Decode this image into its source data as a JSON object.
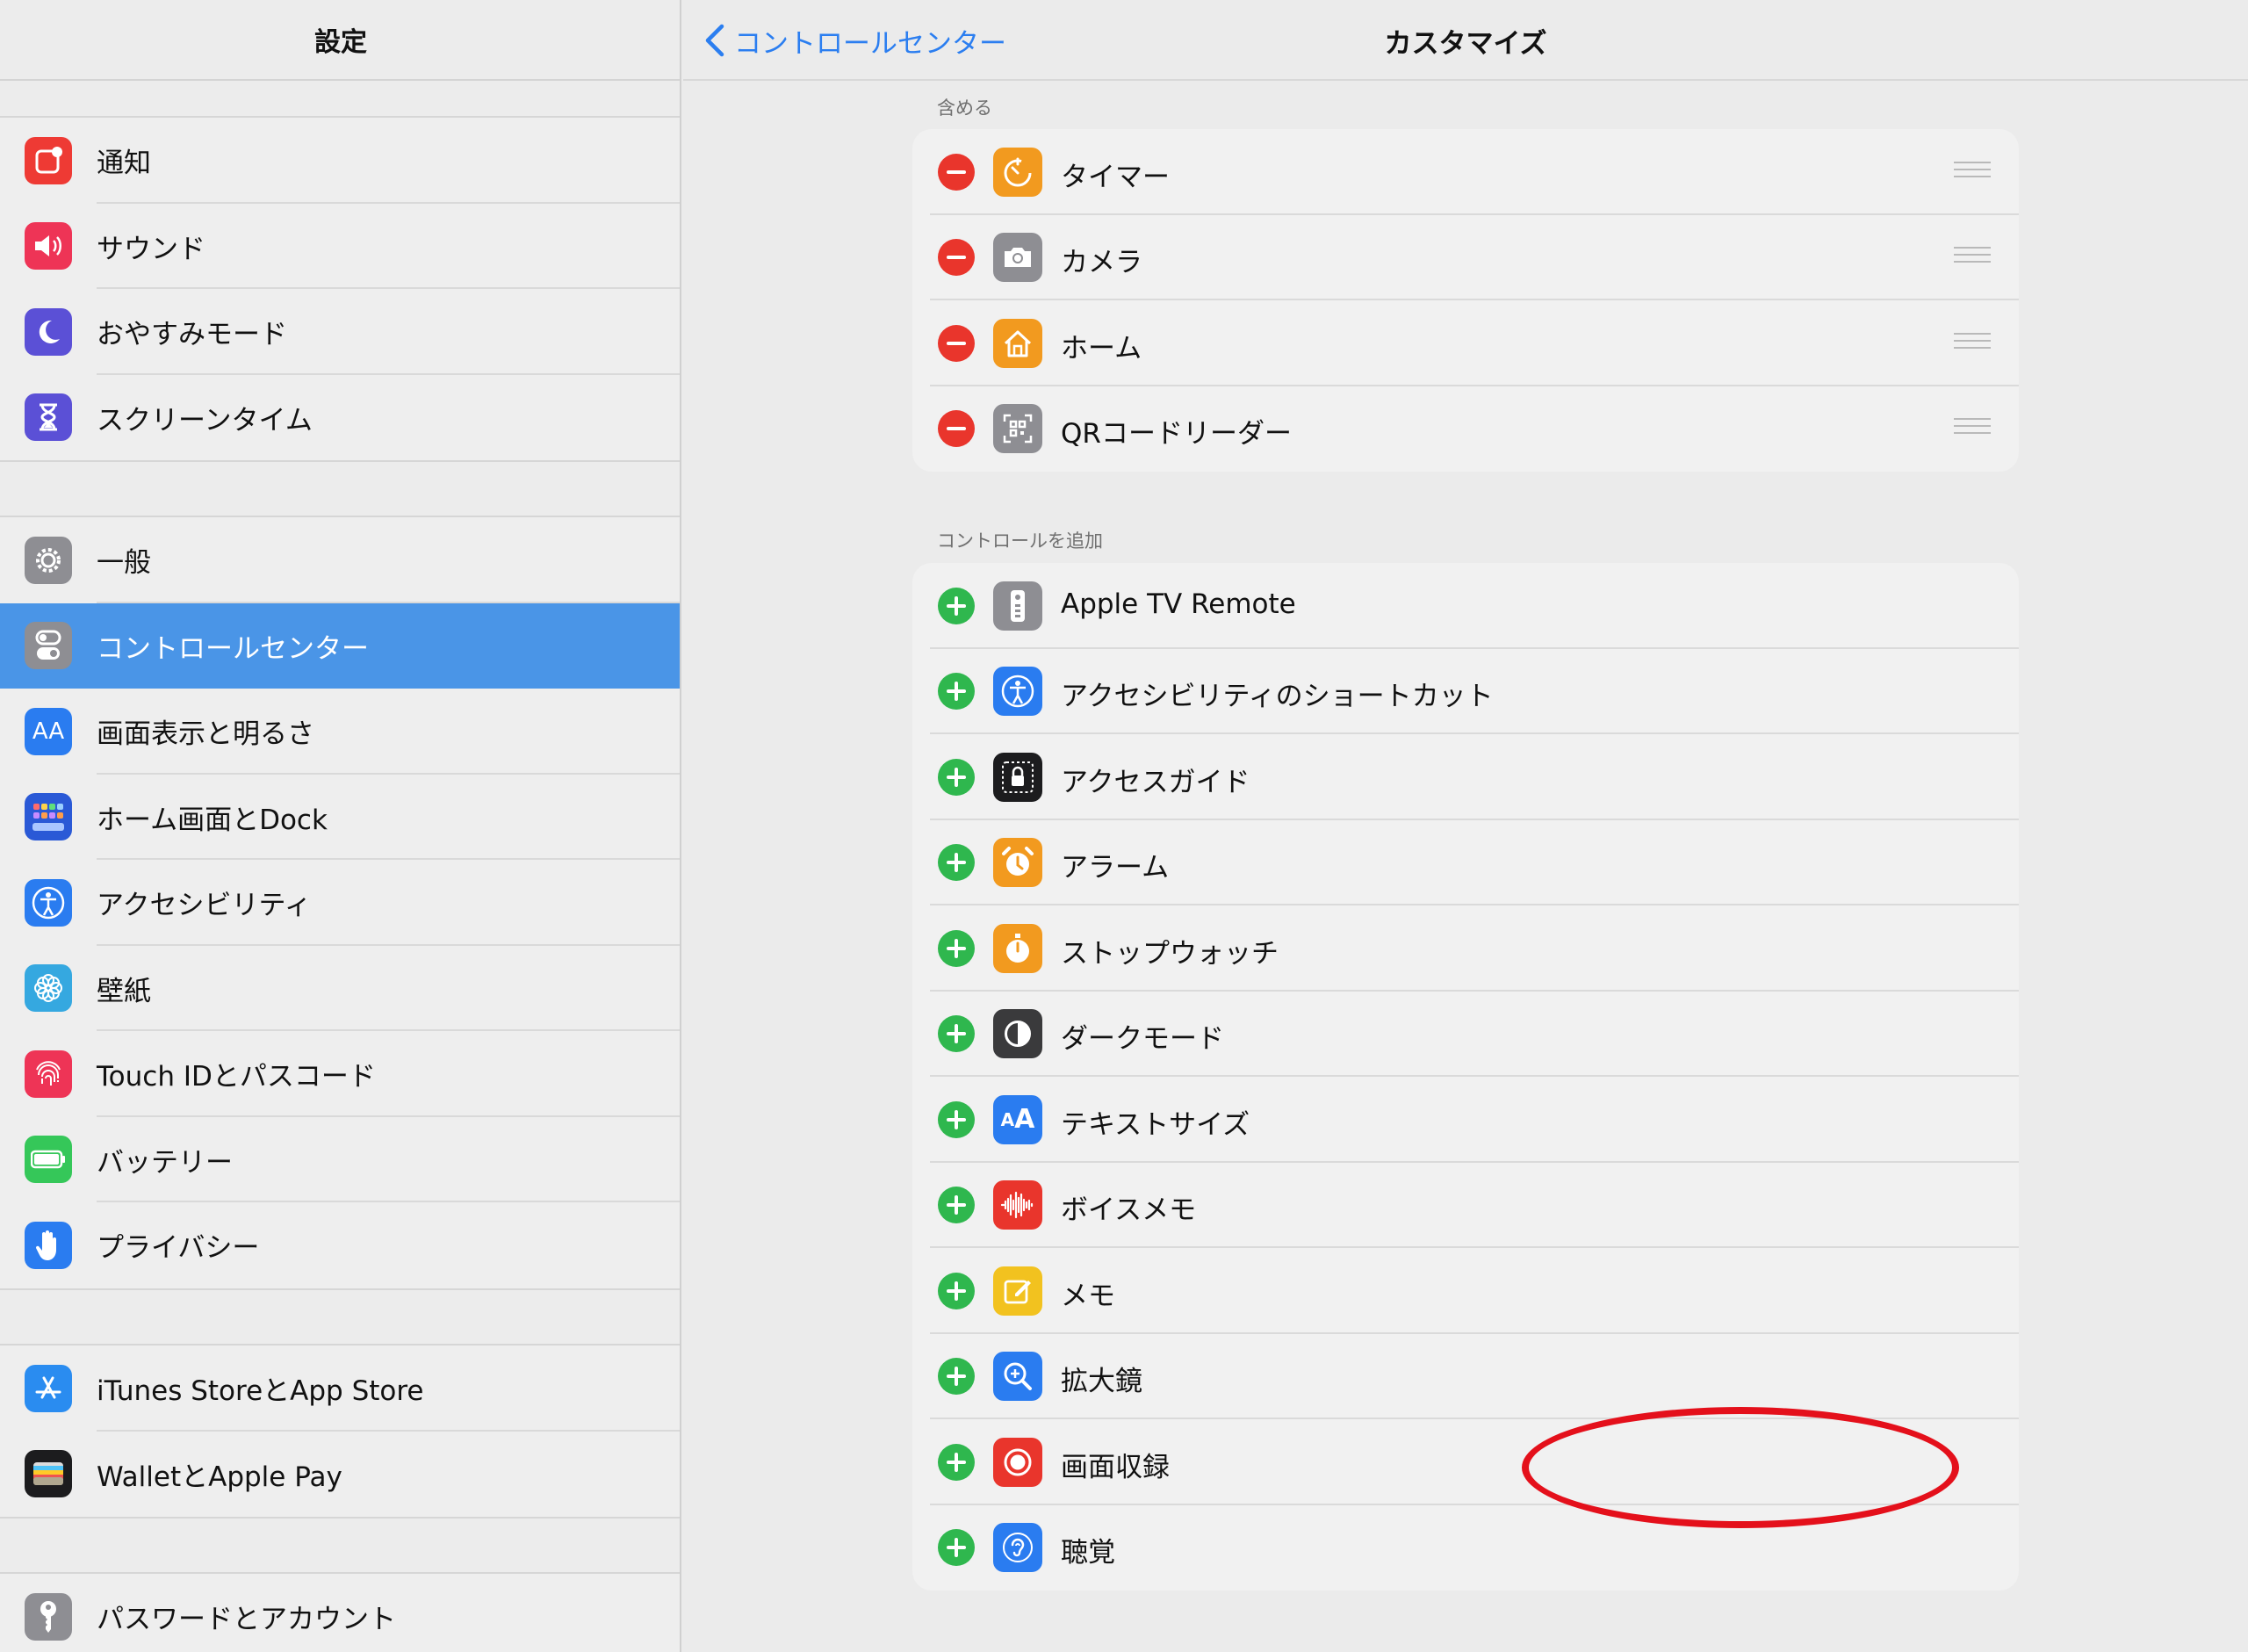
{
  "sidebar": {
    "title": "設定",
    "groups": [
      [
        {
          "label": "通知",
          "icon": "notification-icon",
          "color": "#ee3a34"
        },
        {
          "label": "サウンド",
          "icon": "speaker-icon",
          "color": "#ee3456"
        },
        {
          "label": "おやすみモード",
          "icon": "moon-icon",
          "color": "#5b50d6"
        },
        {
          "label": "スクリーンタイム",
          "icon": "hourglass-icon",
          "color": "#5b50d6"
        }
      ],
      [
        {
          "label": "一般",
          "icon": "gear-icon",
          "color": "#8e8e93"
        },
        {
          "label": "コントロールセンター",
          "icon": "toggles-icon",
          "color": "#8e8e93",
          "selected": true
        },
        {
          "label": "画面表示と明るさ",
          "icon": "aa-text-icon",
          "color": "#2a7cf0"
        },
        {
          "label": "ホーム画面とDock",
          "icon": "app-grid-icon",
          "color": "#2a59d6"
        },
        {
          "label": "アクセシビリティ",
          "icon": "accessibility-icon",
          "color": "#2a7cf0"
        },
        {
          "label": "壁紙",
          "icon": "flower-icon",
          "color": "#35a8e0"
        },
        {
          "label": "Touch IDとパスコード",
          "icon": "fingerprint-icon",
          "color": "#ee3456"
        },
        {
          "label": "バッテリー",
          "icon": "battery-icon",
          "color": "#35c759"
        },
        {
          "label": "プライバシー",
          "icon": "hand-icon",
          "color": "#2a7cf0"
        }
      ],
      [
        {
          "label": "iTunes StoreとApp Store",
          "icon": "app-store-icon",
          "color": "#2a8cf0"
        },
        {
          "label": "WalletとApple Pay",
          "icon": "wallet-icon",
          "color": "#1c1c1e"
        }
      ],
      [
        {
          "label": "パスワードとアカウント",
          "icon": "key-icon",
          "color": "#8e8e93"
        }
      ]
    ]
  },
  "header": {
    "back_label": "コントロールセンター",
    "title": "カスタマイズ"
  },
  "include": {
    "heading": "含める",
    "items": [
      {
        "label": "タイマー",
        "icon": "timer-icon",
        "color": "#f29a1f"
      },
      {
        "label": "カメラ",
        "icon": "camera-icon",
        "color": "#8e8e93"
      },
      {
        "label": "ホーム",
        "icon": "home-icon",
        "color": "#f29a1f"
      },
      {
        "label": "QRコードリーダー",
        "icon": "qr-code-icon",
        "color": "#8e8e93"
      }
    ]
  },
  "more": {
    "heading": "コントロールを追加",
    "items": [
      {
        "label": "Apple TV Remote",
        "icon": "tv-remote-icon",
        "color": "#8e8e93"
      },
      {
        "label": "アクセシビリティのショートカット",
        "icon": "accessibility-icon",
        "color": "#2a7cf0"
      },
      {
        "label": "アクセスガイド",
        "icon": "lock-icon",
        "color": "#1c1c1e"
      },
      {
        "label": "アラーム",
        "icon": "alarm-clock-icon",
        "color": "#f29a1f"
      },
      {
        "label": "ストップウォッチ",
        "icon": "stopwatch-icon",
        "color": "#f29a1f"
      },
      {
        "label": "ダークモード",
        "icon": "dark-mode-icon",
        "color": "#3a3a3c"
      },
      {
        "label": "テキストサイズ",
        "icon": "text-size-icon",
        "color": "#2a7cf0"
      },
      {
        "label": "ボイスメモ",
        "icon": "waveform-icon",
        "color": "#e9352c"
      },
      {
        "label": "メモ",
        "icon": "notes-icon",
        "color": "#f2c21f"
      },
      {
        "label": "拡大鏡",
        "icon": "magnifier-icon",
        "color": "#2a7cf0"
      },
      {
        "label": "画面収録",
        "icon": "screen-record-icon",
        "color": "#e9352c"
      },
      {
        "label": "聴覚",
        "icon": "ear-icon",
        "color": "#2a7cf0"
      }
    ]
  },
  "colors": {
    "accent": "#2b7ef0",
    "selected_row": "#4a95e7",
    "remove": "#e9352c",
    "add": "#2fb74e",
    "annotation_ring": "#e4101b"
  }
}
